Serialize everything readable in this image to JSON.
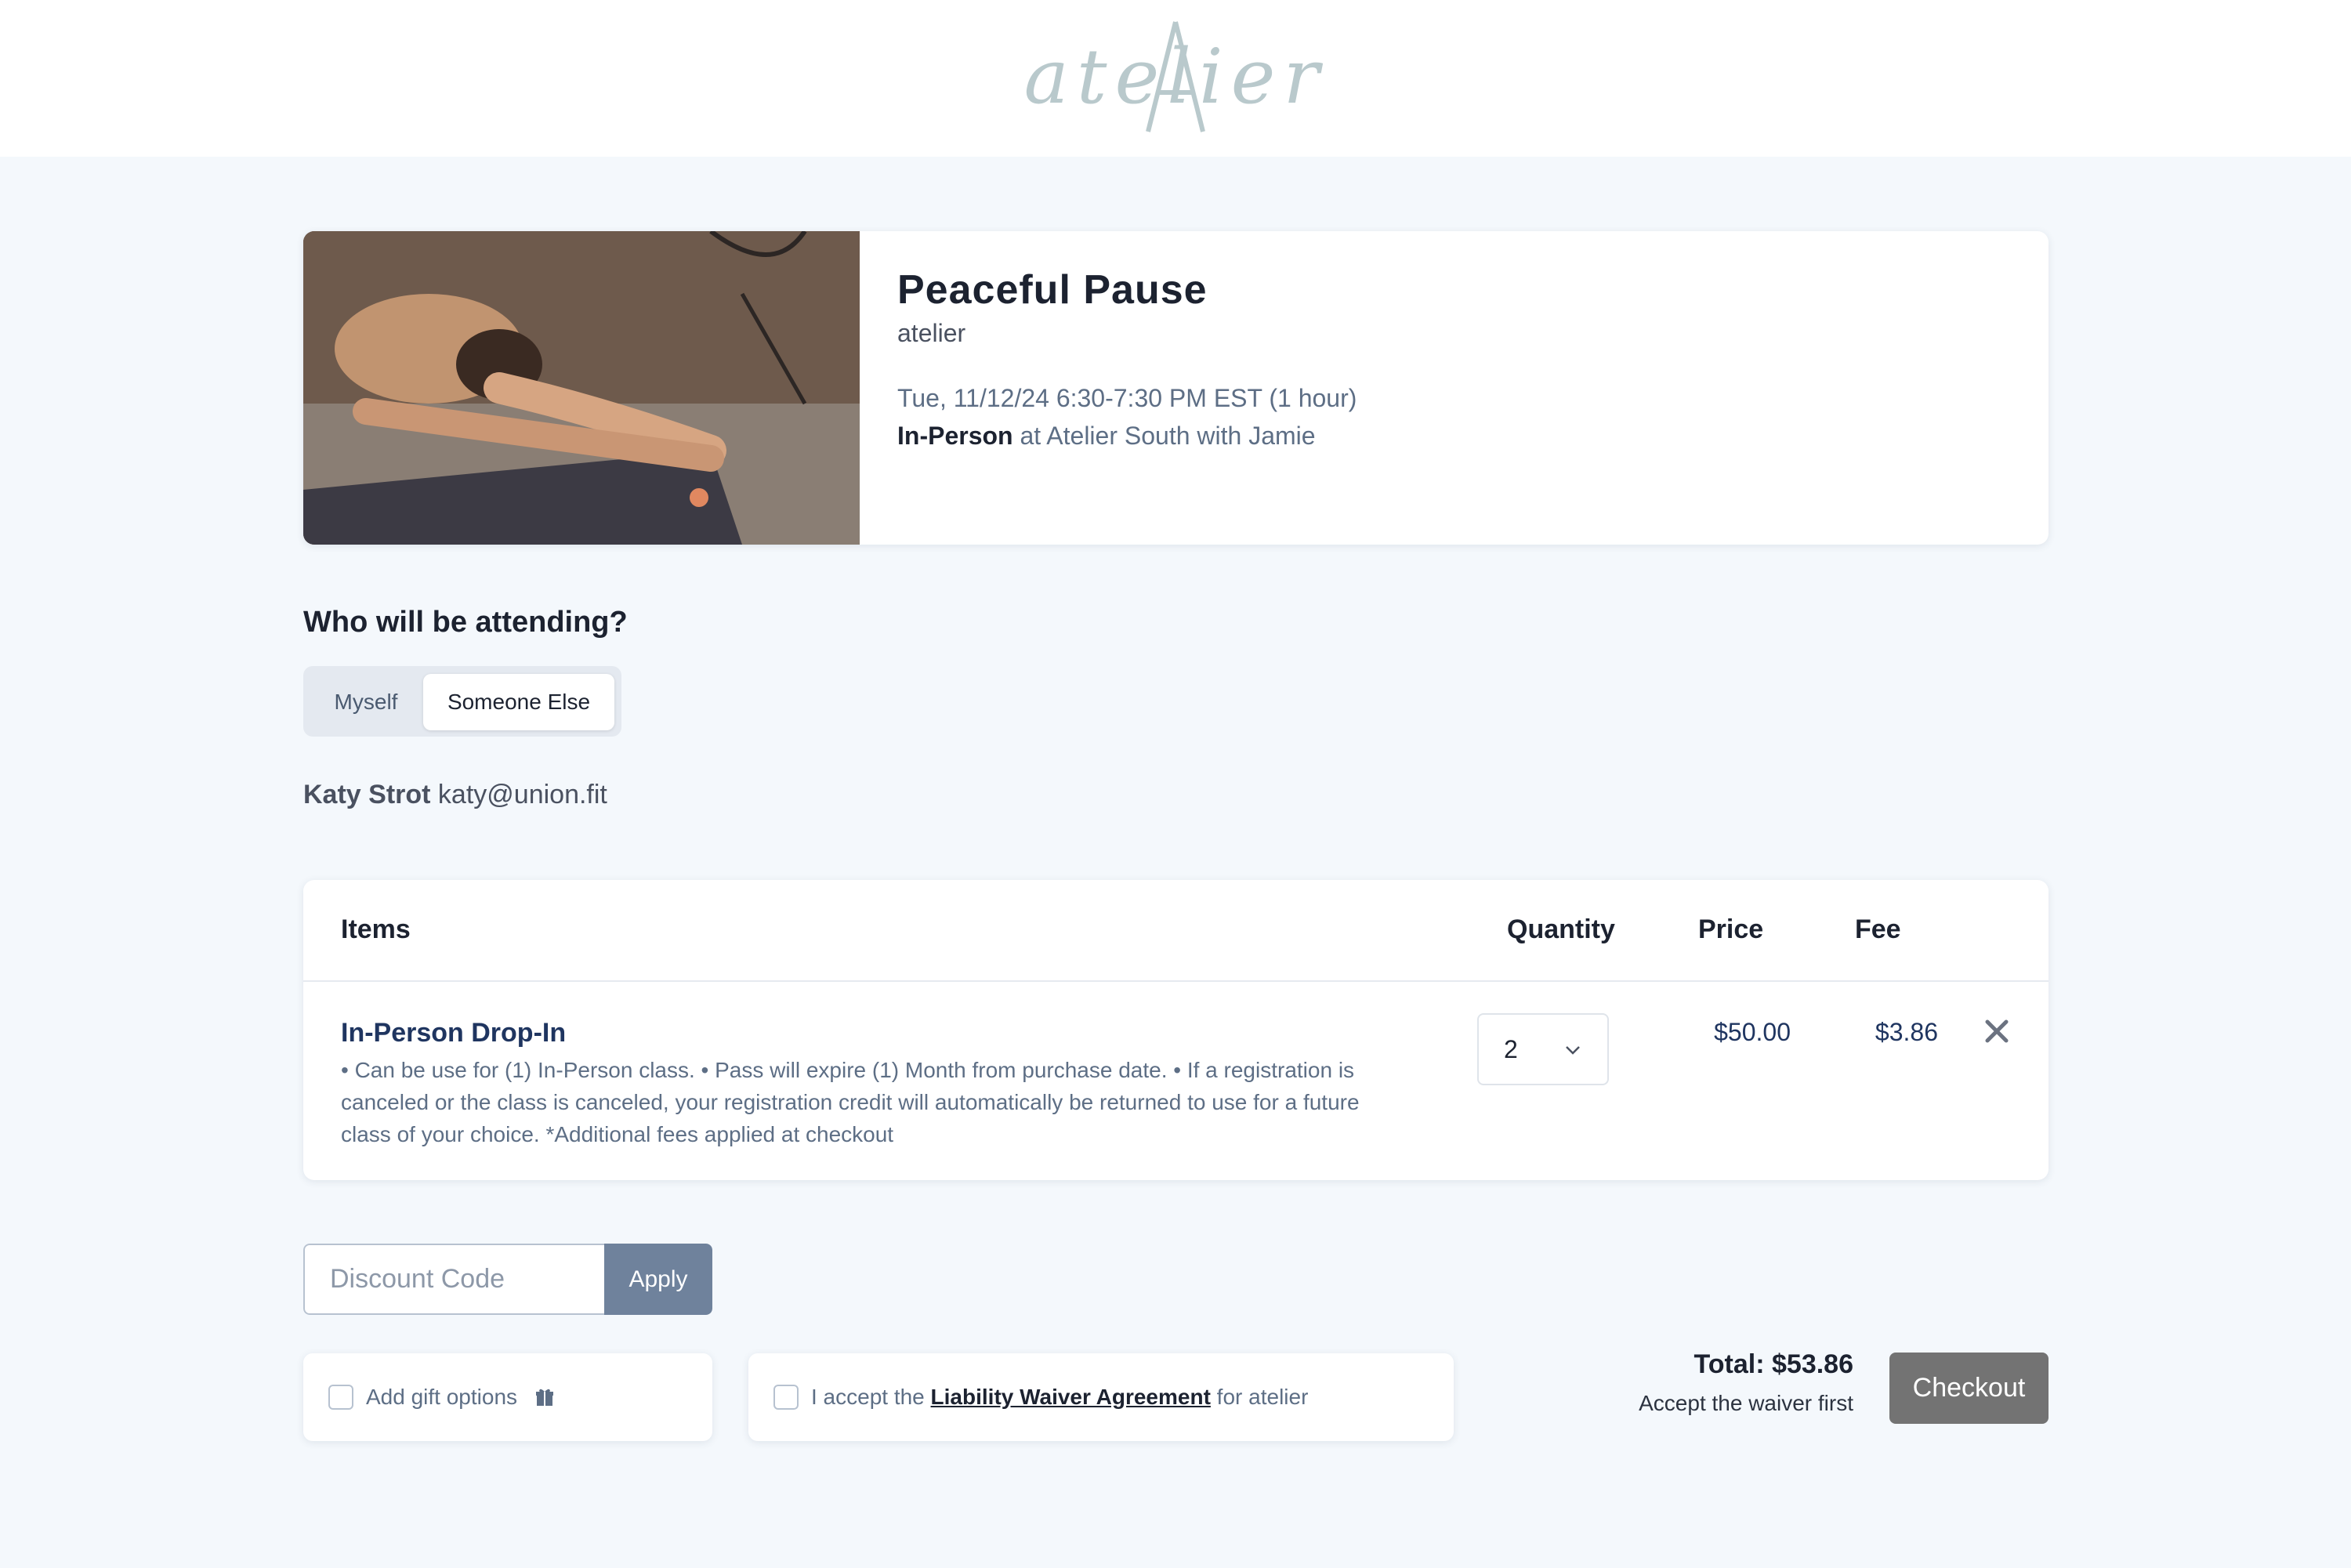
{
  "brand": {
    "logo_text": "atelier"
  },
  "event": {
    "title": "Peaceful Pause",
    "organization": "atelier",
    "datetime": "Tue, 11/12/24 6:30-7:30 PM EST (1 hour)",
    "mode": "In-Person",
    "location_suffix": " at Atelier South with Jamie"
  },
  "attendance": {
    "heading": "Who will be attending?",
    "options": [
      "Myself",
      "Someone Else"
    ],
    "selected": "Someone Else",
    "person_name": "Katy Strot",
    "person_email": "katy@union.fit"
  },
  "items_table": {
    "headers": {
      "items": "Items",
      "quantity": "Quantity",
      "price": "Price",
      "fee": "Fee"
    },
    "rows": [
      {
        "name": "In-Person Drop-In",
        "description": "• Can be use for (1) In-Person class. • Pass will expire (1) Month from purchase date.  • If a registration is canceled or the class is canceled, your registration credit will automatically be returned to use for a future class of your choice.  *Additional fees applied at checkout",
        "quantity": "2",
        "price": "$50.00",
        "fee": "$3.86"
      }
    ]
  },
  "discount": {
    "placeholder": "Discount Code",
    "apply_label": "Apply"
  },
  "gift": {
    "label": "Add gift options"
  },
  "waiver": {
    "prefix": "I accept the ",
    "link": "Liability Waiver Agreement",
    "suffix": " for atelier"
  },
  "checkout": {
    "total": "Total: $53.86",
    "note": "Accept the waiver first",
    "button_label": "Checkout"
  },
  "colors": {
    "page_bg": "#f4f8fc",
    "apply_button": "#6f829c",
    "checkout_button_disabled": "#737373",
    "item_name": "#1f3560"
  }
}
